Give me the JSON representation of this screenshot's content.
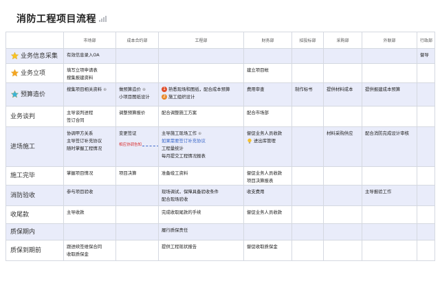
{
  "title": "消防工程项目流程",
  "columns": [
    "",
    "市场部",
    "成本合约部",
    "工程部",
    "财务部",
    "招投标部",
    "采购部",
    "外联部",
    "行政部"
  ],
  "rows": [
    {
      "label": "业务信息采集",
      "icon": "gold-star-icon",
      "style": "alt",
      "cells": [
        [
          "有效信息录入OA"
        ],
        [],
        [],
        [],
        [],
        [],
        [],
        [
          "督导"
        ]
      ]
    },
    {
      "label": "业务立项",
      "icon": "orange-star-icon",
      "style": "plain",
      "cells": [
        [
          "填写立项申请表",
          "搜集报建资料"
        ],
        [],
        [],
        [
          "建立项目帐"
        ],
        [],
        [],
        [],
        []
      ]
    },
    {
      "label": "预算造价",
      "icon": "teal-star-icon",
      "style": "alt",
      "cells": [
        [
          "搜集项目相关资料"
        ],
        [
          "做预算造价",
          "小项目图纸设计"
        ],
        [
          "熟悉现场和图纸，配合成本预算",
          "施工组织设计"
        ],
        [
          "费用审查"
        ],
        [
          "制作标书"
        ],
        [
          "提供材料成本"
        ],
        [
          "提供报建成本预算"
        ],
        []
      ]
    },
    {
      "label": "业务谈判",
      "icon": "",
      "style": "plain",
      "cells": [
        [
          "主导谈判进程",
          "签订合同"
        ],
        [
          "调整预算报价"
        ],
        [
          "配合调整施工方案"
        ],
        [
          "配合市场部"
        ],
        [],
        [],
        [],
        []
      ]
    },
    {
      "label": "进场施工",
      "icon": "",
      "style": "alt",
      "cells": [
        [
          "协调甲方关系",
          "主导签订补充协议",
          "随时掌握工程情况"
        ],
        [
          "变更签证",
          "相应协调告知"
        ],
        [
          "主导施工现场工作",
          "如果需要签订补充协议",
          "工程量统计",
          "每月提交工程情况报表"
        ],
        [
          "督促业务人员收款",
          "进出库管理"
        ],
        [],
        [
          "材料采购供应"
        ],
        [
          "配合消防完成设计审核"
        ],
        []
      ]
    },
    {
      "label": "施工完毕",
      "icon": "",
      "style": "plain",
      "cells": [
        [
          "掌握项目情况"
        ],
        [
          "项目决算"
        ],
        [
          "准备竣工资料"
        ],
        [
          "督促业务人员收款",
          "项目决算报表"
        ],
        [],
        [],
        [],
        []
      ]
    },
    {
      "label": "消防验收",
      "icon": "",
      "style": "alt",
      "cells": [
        [
          "参与项目验收"
        ],
        [],
        [
          "现场调试，保障具备验收条件",
          "配合现场验收"
        ],
        [
          "收支费用"
        ],
        [],
        [],
        [
          "主导报验工作"
        ],
        []
      ]
    },
    {
      "label": "收尾款",
      "icon": "",
      "style": "plain",
      "cells": [
        [
          "主导收款"
        ],
        [],
        [
          "完成收取尾款的手续"
        ],
        [
          "督促业务人员收款"
        ],
        [],
        [],
        [],
        []
      ]
    },
    {
      "label": "质保期内",
      "icon": "",
      "style": "alt",
      "cells": [
        [],
        [],
        [
          "履行质保责任"
        ],
        [],
        [],
        [],
        [],
        []
      ]
    },
    {
      "label": "质保到期前",
      "icon": "",
      "style": "plain",
      "cells": [
        [
          "跟进续签维保合同",
          "收取质保金"
        ],
        [],
        [
          "提供工程现状报告"
        ],
        [
          "督促收取质保金"
        ],
        [],
        [],
        [],
        []
      ]
    }
  ],
  "colors": {
    "alt_row": "#e9ecfa",
    "border": "#d4d8e0",
    "note_red": "#d92b2b",
    "arrow_blue": "#3a67c9"
  }
}
